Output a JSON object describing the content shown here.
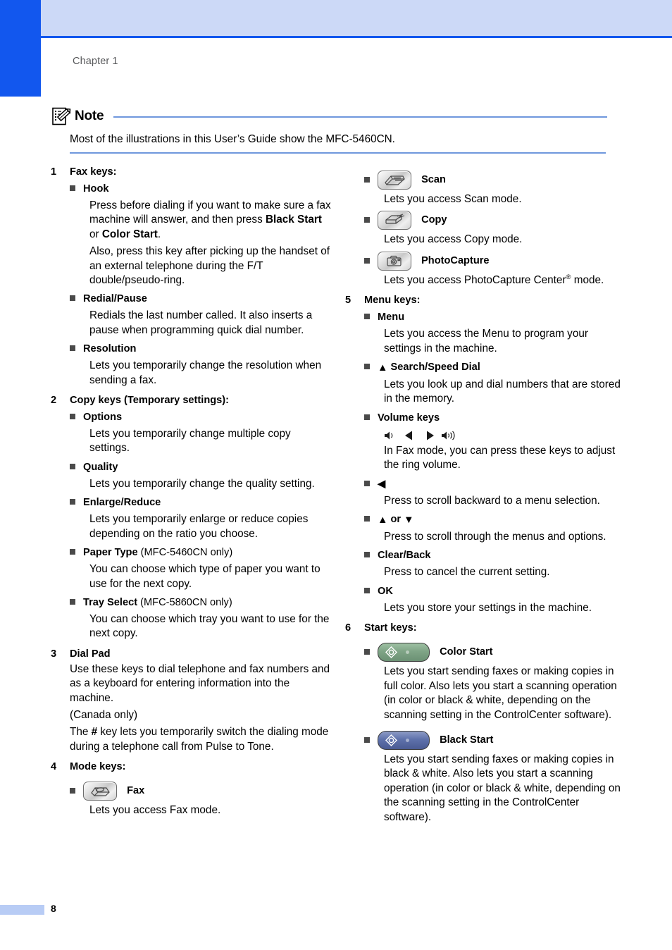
{
  "page": {
    "chapter_label": "Chapter 1",
    "page_number": "8",
    "accent_blue": "#1257ee",
    "header_band_color": "#ccd9f7",
    "rule_color": "#6f97dd",
    "footer_bar_color": "#b8ccf5"
  },
  "note": {
    "icon": "note-pencil-icon",
    "title": "Note",
    "body": "Most of the illustrations in this User’s Guide show the MFC-5460CN."
  },
  "sections": {
    "fax_keys": {
      "number": "1",
      "title": "Fax keys:",
      "hook": {
        "label": "Hook",
        "p1_a": "Press before dialing if you want to make sure a fax machine will answer, and then press ",
        "p1_b": "Black Start",
        "p1_c": " or ",
        "p1_d": "Color Start",
        "p1_e": ".",
        "p2": "Also, press this key after picking up the handset of an external telephone during the F/T double/pseudo-ring."
      },
      "redial": {
        "label": "Redial/Pause",
        "p1": "Redials the last number called. It also inserts a pause when programming quick dial number."
      },
      "resolution": {
        "label": "Resolution",
        "p1": "Lets you temporarily change the resolution when sending a fax."
      }
    },
    "copy_keys": {
      "number": "2",
      "title": "Copy keys (Temporary settings):",
      "options": {
        "label": "Options",
        "p1": "Lets you temporarily change multiple copy settings."
      },
      "quality": {
        "label": "Quality",
        "p1": "Lets you temporarily change the quality setting."
      },
      "enlarge_reduce": {
        "label": "Enlarge/Reduce",
        "p1": "Lets you temporarily enlarge or reduce copies depending on the ratio you choose."
      },
      "paper_type": {
        "label": "Paper Type",
        "qualifier": " (MFC-5460CN only)",
        "p1": "You can choose which type of paper you want to use for the next copy."
      },
      "tray_select": {
        "label": "Tray Select",
        "qualifier": " (MFC-5860CN only)",
        "p1": "You can choose which tray you want to use for the next copy."
      }
    },
    "dial_pad": {
      "number": "3",
      "title": "Dial Pad",
      "p1": "Use these keys to dial telephone and fax numbers and as a keyboard for entering information into the machine.",
      "p2": "(Canada only)",
      "p3_a": "The ",
      "p3_b": "#",
      "p3_c": " key lets you temporarily switch the dialing mode during a telephone call from Pulse to Tone."
    },
    "mode_keys": {
      "number": "4",
      "title": "Mode keys:",
      "fax": {
        "icon": "fax-key-icon",
        "label": "Fax",
        "p1": "Lets you access Fax mode."
      },
      "scan": {
        "icon": "scan-key-icon",
        "label": "Scan",
        "p1": "Lets you access Scan mode."
      },
      "copy": {
        "icon": "copy-key-icon",
        "label": "Copy",
        "p1": "Lets you access Copy mode."
      },
      "photocapture": {
        "icon": "photocapture-key-icon",
        "label": "PhotoCapture",
        "p1_a": "Lets you access PhotoCapture Center",
        "p1_sup": "®",
        "p1_b": " mode."
      }
    },
    "menu_keys": {
      "number": "5",
      "title": "Menu keys:",
      "menu": {
        "label": "Menu",
        "p1": "Lets you access the Menu to program your settings in the machine."
      },
      "search_speed_dial": {
        "arrow": "▲",
        "label": " Search/Speed Dial",
        "p1": "Lets you look up and dial numbers that are stored in the memory."
      },
      "volume_keys": {
        "label": "Volume keys",
        "glyphs": "speaker-low-icon, left-triangle-icon, right-triangle-icon, speaker-high-icon",
        "p1": "In Fax mode, you can press these keys to adjust the ring volume."
      },
      "left_arrow": {
        "label": "◀",
        "p1": "Press to scroll backward to a menu selection."
      },
      "up_down": {
        "label_a": "▲",
        "label_or": " or ",
        "label_b": "▼",
        "p1": "Press to scroll through the menus and options."
      },
      "clear_back": {
        "label": "Clear/Back",
        "p1": "Press to cancel the current setting."
      },
      "ok": {
        "label": "OK",
        "p1": "Lets you store your settings in the machine."
      }
    },
    "start_keys": {
      "number": "6",
      "title": "Start keys:",
      "color_start": {
        "icon": "color-start-key-icon",
        "color": "#7fa486",
        "label": "Color Start",
        "p1": "Lets you start sending faxes or making copies in full color. Also lets you start a scanning operation (in color or black & white, depending on the scanning setting in the ControlCenter software)."
      },
      "black_start": {
        "icon": "black-start-key-icon",
        "color": "#5e71ab",
        "label": "Black Start",
        "p1": "Lets you start sending faxes or making copies in black & white. Also lets you start a scanning operation (in color or black & white, depending on the scanning setting in the ControlCenter software)."
      }
    }
  }
}
